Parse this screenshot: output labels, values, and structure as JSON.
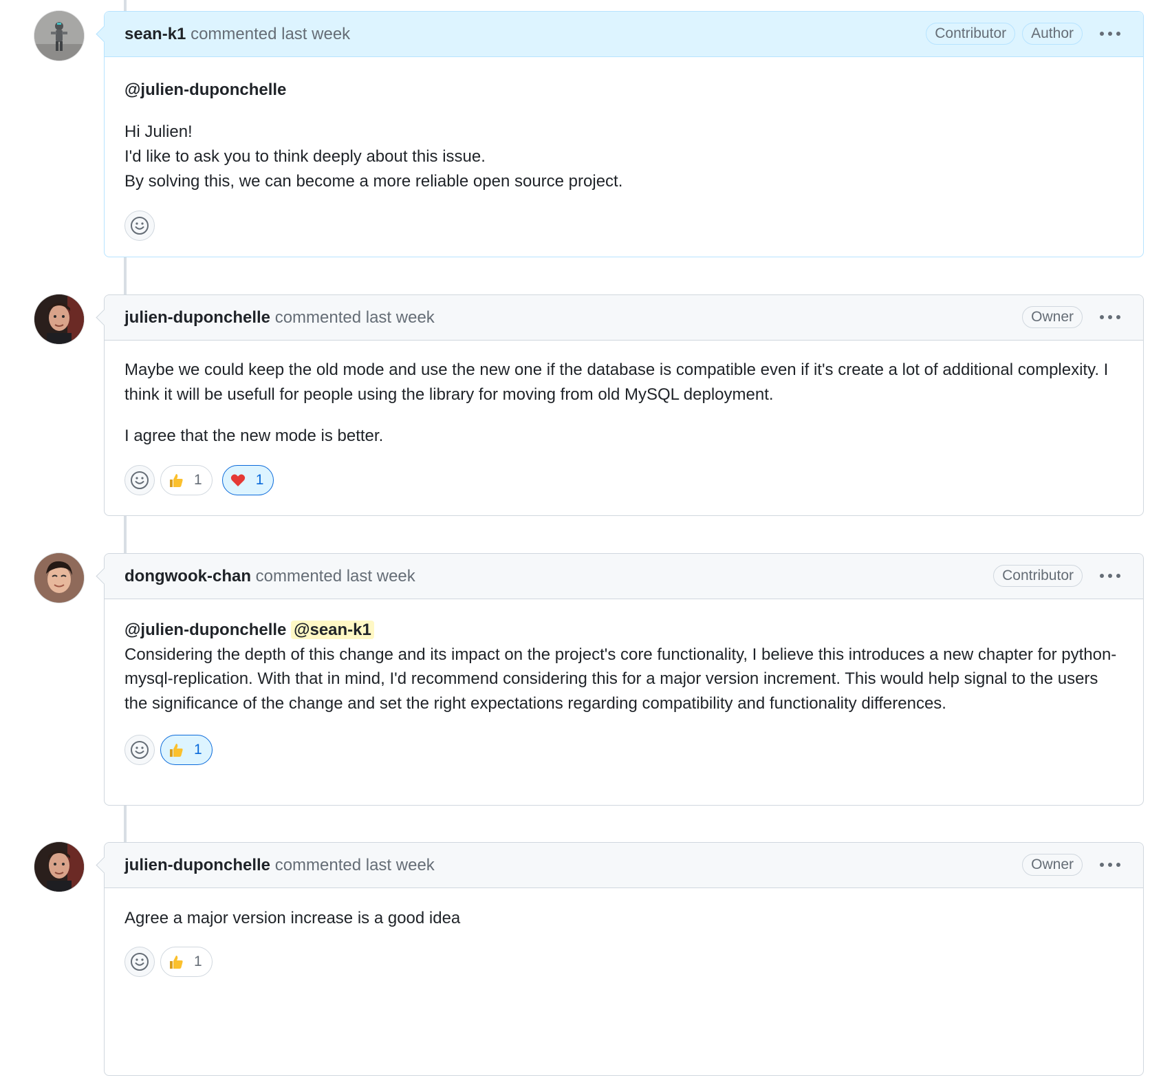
{
  "comments": [
    {
      "author": "sean-k1",
      "time": "commented last week",
      "badges": [
        "Contributor",
        "Author"
      ],
      "mention": "@julien-duponchelle",
      "paragraphs": [
        "Hi Julien!",
        "I'd like to ask you to think deeply about this issue.",
        "By solving this, we can become a more reliable open source project."
      ],
      "reactions": []
    },
    {
      "author": "julien-duponchelle",
      "time": "commented last week",
      "badges": [
        "Owner"
      ],
      "paragraphs": [
        "Maybe we could keep the old mode and use the new one if the database is compatible even if it's create a lot of additional complexity. I think it will be usefull for people using the library for moving from old MySQL deployment.",
        "I agree that the new mode is better."
      ],
      "reactions": [
        {
          "emoji": "thumbs-up",
          "count": "1"
        },
        {
          "emoji": "heart",
          "count": "1"
        }
      ]
    },
    {
      "author": "dongwook-chan",
      "time": "commented last week",
      "badges": [
        "Contributor"
      ],
      "mention": "@julien-duponchelle",
      "mention2": "@sean-k1",
      "paragraphs": [
        "Considering the depth of this change and its impact on the project's core functionality, I believe this introduces a new chapter for python-mysql-replication. With that in mind, I'd recommend considering this for a major version increment. This would help signal to the users the significance of the change and set the right expectations regarding compatibility and functionality differences."
      ],
      "reactions": [
        {
          "emoji": "thumbs-up",
          "count": "1"
        }
      ]
    },
    {
      "author": "julien-duponchelle",
      "time": "commented last week",
      "badges": [
        "Owner"
      ],
      "paragraphs": [
        "Agree a major version increase is a good idea"
      ],
      "reactions": [
        {
          "emoji": "thumbs-up",
          "count": "1"
        }
      ]
    }
  ],
  "colors": {
    "author_header_bg": "#ddf4ff",
    "header_bg": "#f6f8fa",
    "active_reaction": "#0969da",
    "mention_highlight": "#fff8c5"
  }
}
